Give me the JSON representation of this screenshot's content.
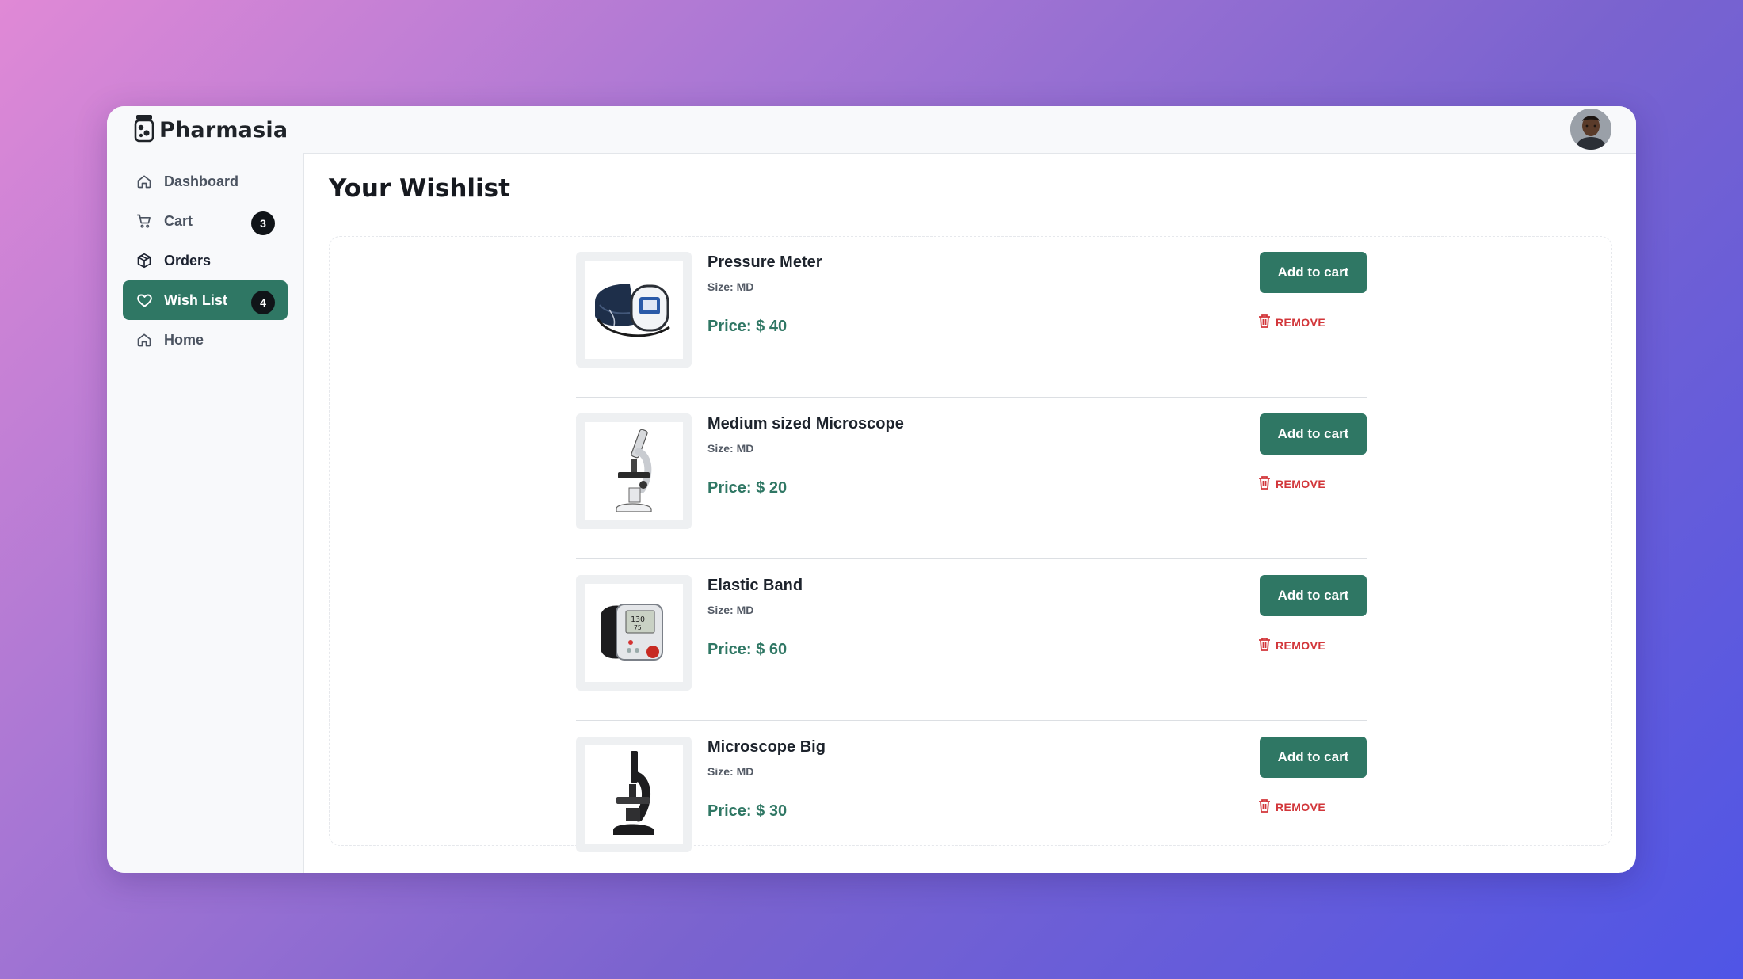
{
  "app": {
    "name": "Pharmasia"
  },
  "nav": {
    "items": [
      {
        "label": "Dashboard",
        "icon": "home-icon",
        "badge": null,
        "active": false
      },
      {
        "label": "Cart",
        "icon": "cart-icon",
        "badge": "3",
        "active": false
      },
      {
        "label": "Orders",
        "icon": "box-icon",
        "badge": null,
        "active": false
      },
      {
        "label": "Wish List",
        "icon": "heart-icon",
        "badge": "4",
        "active": true
      },
      {
        "label": "Home",
        "icon": "home-icon",
        "badge": null,
        "active": false
      }
    ]
  },
  "page": {
    "title": "Your Wishlist"
  },
  "wishlist": [
    {
      "name": "Pressure Meter",
      "size": "Size: MD",
      "price": "Price: $ 40",
      "add_label": "Add to cart",
      "remove_label": "REMOVE",
      "image": "blood-pressure-cuff"
    },
    {
      "name": "Medium sized Microscope",
      "size": "Size: MD",
      "price": "Price: $ 20",
      "add_label": "Add to cart",
      "remove_label": "REMOVE",
      "image": "white-microscope"
    },
    {
      "name": "Elastic Band",
      "size": "Size: MD",
      "price": "Price: $ 60",
      "add_label": "Add to cart",
      "remove_label": "REMOVE",
      "image": "wrist-bp-monitor"
    },
    {
      "name": "Microscope Big",
      "size": "Size: MD",
      "price": "Price: $ 30",
      "add_label": "Add to cart",
      "remove_label": "REMOVE",
      "image": "black-microscope"
    }
  ],
  "colors": {
    "accent": "#2f7764",
    "danger": "#d2363a",
    "badge": "#101418"
  }
}
